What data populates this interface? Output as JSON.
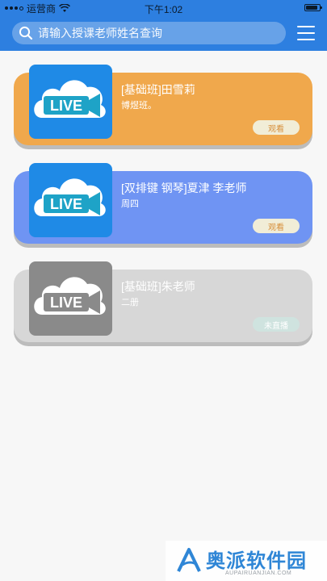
{
  "status_bar": {
    "carrier": "运营商",
    "time": "下午1:02"
  },
  "search": {
    "placeholder": "请输入授课老师姓名查询"
  },
  "colors": {
    "header": "#2d7fe0",
    "card_orange": "#f0a84c",
    "card_blue": "#6f94f3",
    "card_gray": "#d7d7d7"
  },
  "icons": {
    "search": "search-icon",
    "menu": "hamburger-menu-icon",
    "live": "live-video-cloud-icon"
  },
  "courses": [
    {
      "title": "[基础班]田雪莉",
      "subtitle": "博煜班。",
      "button": "观看",
      "live_label": "LIVE"
    },
    {
      "title": "[双排键 钢琴]夏津 李老师",
      "subtitle": "周四",
      "button": "观看",
      "live_label": "LIVE"
    },
    {
      "title": "[基础班]朱老师",
      "subtitle": "二册",
      "button": "未直播",
      "live_label": "LIVE"
    }
  ],
  "watermark": {
    "name": "奥派软件园",
    "url": "AUPAIRUANJIAN.COM"
  }
}
